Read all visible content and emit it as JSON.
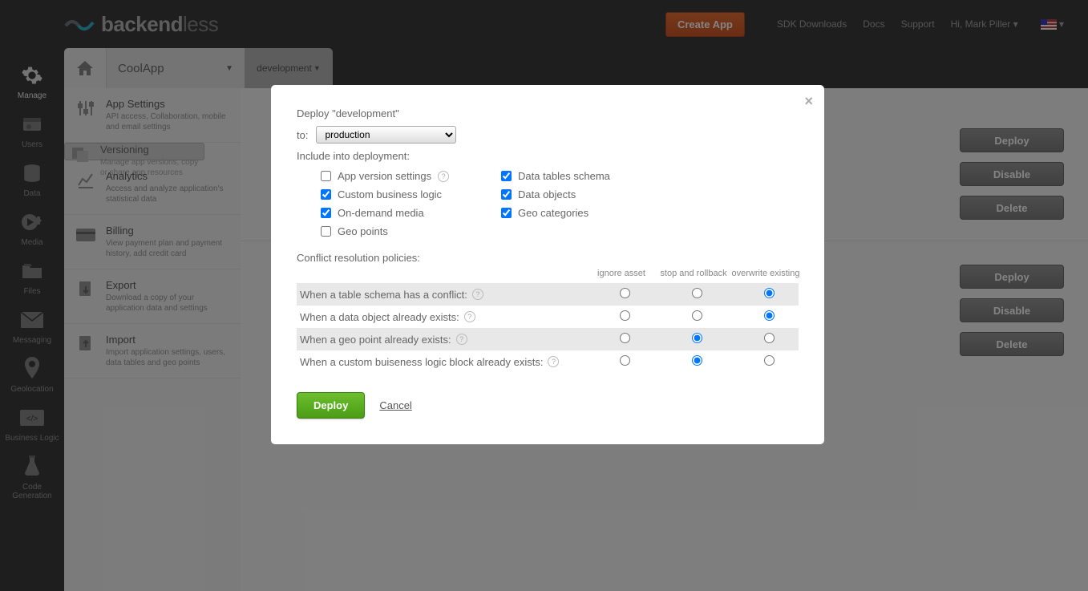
{
  "header": {
    "brand_a": "backend",
    "brand_b": "less",
    "create_app": "Create App",
    "links": [
      "SDK Downloads",
      "Docs",
      "Support",
      "Hi, Mark Piller"
    ]
  },
  "appbar": {
    "app": "CoolApp",
    "env": "development"
  },
  "rail": {
    "items": [
      {
        "label": "Manage",
        "active": true
      },
      {
        "label": "Users"
      },
      {
        "label": "Data"
      },
      {
        "label": "Media"
      },
      {
        "label": "Files"
      },
      {
        "label": "Messaging"
      },
      {
        "label": "Geolocation"
      },
      {
        "label": "Business Logic"
      },
      {
        "label": "Code Generation"
      }
    ]
  },
  "sidebar": {
    "items": [
      {
        "t": "App Settings",
        "d": "API access, Collaboration, mobile and email settings"
      },
      {
        "t": "Versioning",
        "d": "Manage app versions, copy or share app resources"
      },
      {
        "t": "Analytics",
        "d": "Access and analyze application's statistical data"
      },
      {
        "t": "Billing",
        "d": "View payment plan and payment history, add credit card"
      },
      {
        "t": "Export",
        "d": "Download a copy of your application data and settings"
      },
      {
        "t": "Import",
        "d": "Import application settings, users, data tables and geo points"
      }
    ]
  },
  "buttons": {
    "deploy": "Deploy",
    "disable": "Disable",
    "delete": "Delete"
  },
  "modal": {
    "title": "Deploy \"development\"",
    "to_label": "to:",
    "target": "production",
    "include_label": "Include into deployment:",
    "checks": {
      "app_version": {
        "label": "App version settings",
        "checked": false,
        "help": true
      },
      "data_schema": {
        "label": "Data tables schema",
        "checked": true
      },
      "custom_logic": {
        "label": "Custom business logic",
        "checked": true
      },
      "data_objects": {
        "label": "Data objects",
        "checked": true
      },
      "ondemand_media": {
        "label": "On-demand media",
        "checked": true
      },
      "geo_cat": {
        "label": "Geo categories",
        "checked": true
      },
      "geo_pts": {
        "label": "Geo points",
        "checked": false
      }
    },
    "pol_label": "Conflict resolution policies:",
    "pol_cols": [
      "ignore asset",
      "stop and rollback",
      "overwrite existing"
    ],
    "pol_rows": [
      {
        "label": "When a table schema has a conflict:",
        "sel": 2
      },
      {
        "label": "When a data object already exists:",
        "sel": 2
      },
      {
        "label": "When a geo point already exists:",
        "sel": 1
      },
      {
        "label": "When a custom buiseness logic block already exists:",
        "sel": 1
      }
    ],
    "deploy_btn": "Deploy",
    "cancel": "Cancel"
  }
}
